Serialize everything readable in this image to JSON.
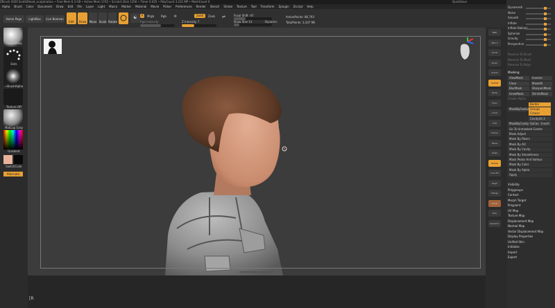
{
  "titlebar": {
    "text": "ZBrush 2020  Scott4Head_sculptnation  • Free Mem 6.3 GB • Active Mem 1745 • Scratch Disk 1356 • Timer 0.025 • PolyCount 3.221 MP • MeshCount 0",
    "quicksave": "QuickSave",
    "layout": "DefaultZScript"
  },
  "menu": [
    "Alpha",
    "Brush",
    "Color",
    "Document",
    "Draw",
    "Edit",
    "File",
    "Layer",
    "Light",
    "Macro",
    "Marker",
    "Material",
    "Movie",
    "Picker",
    "Preferences",
    "Render",
    "Stencil",
    "Stroke",
    "Texture",
    "Tool",
    "Transform",
    "Zplugin",
    "Zscript",
    "Help"
  ],
  "toolbar": {
    "home_page": "Home Page",
    "lightbox": "LightBox",
    "live_boolean": "Live Boolean",
    "edit": "Edit",
    "draw": "Draw",
    "move": "Move",
    "scale": "Scale",
    "rotate": "Rotate",
    "a": "A",
    "mrgb": "Mrgb",
    "rgb": "Rgb",
    "m": "M",
    "zadd": "Zadd",
    "zsub": "Zsub",
    "rgb_intensity": "Rgb Intensity",
    "z_intensity": "Z Intensity 7",
    "focal_shift": "Focal Shift -47",
    "draw_size": "Draw Size 13",
    "dynamic": "Dynamic",
    "active_points": "ActivePoints: 86,793",
    "total_points": "TotalPoints: 3,347 Mil",
    "coords": "-0.455,-0.063,0.364"
  },
  "left": {
    "brush": "ClayBuildup",
    "stroke": "Dots",
    "alpha": "~BrushAlpha",
    "texture": "Texture Off",
    "material": "MatCap Gray",
    "gradient": "Gradient",
    "switch_color": "SwitchColor",
    "alternate": "Alternate"
  },
  "rightshelf": [
    "BPR",
    "SPix 3",
    "Scroll",
    "Zoom",
    "Actual",
    "AAHalf",
    "Persp",
    "Floor",
    "Local",
    "XYZ",
    "Frame",
    "Move",
    "Scale",
    "Rotate",
    "Line Fill",
    "PolyF",
    "Transp",
    "Ghost",
    "Solo",
    "Dynamic"
  ],
  "rightpanel": {
    "top_items": [
      "Dynamesh",
      "Noise",
      "Smooth",
      "Inflate",
      "Inflate Balloon",
      "Spherize",
      "Gravity",
      "Perspective"
    ],
    "reverse": [
      "Reverse To Brush",
      "Reverse To Mask",
      "Reverse To Polys"
    ],
    "masking_title": "Masking",
    "view_mask": "ViewMask",
    "inverse": "Inverse",
    "clear": "Clear",
    "mask_all": "MaskAll",
    "blur_mask": "BlurMask",
    "sharpen_mask": "SharpenMask",
    "grow_mask": "GrowMask",
    "shrink_mask": "ShrinkMask",
    "create_alpha": "Create Alpha",
    "mask_by_feature": "MaskByFeature",
    "border": "Border",
    "groups": "Groups",
    "crease": "Crease",
    "mask_by_cavity": "MaskByCavity",
    "cavity_intensity": "CavityInt 2",
    "sacs": "SaCav",
    "invert": "Invert",
    "mask_items": [
      "Go To Unmasked Center",
      "Mask Adjust",
      "Mask By Fibers",
      "Mask By AO",
      "Mask By Cavity",
      "Mask By Smoothness",
      "Mask Peaks And Valleys",
      "Mask By Color",
      "Mask By Alpha",
      "Apply"
    ],
    "lower_items": [
      "Visibility",
      "Polygroups",
      "Contact",
      "Morph Target",
      "Polypaint",
      "UV Map",
      "Texture Map",
      "Displacement Map",
      "Normal Map",
      "Vector Displacement Map",
      "Display Properties",
      "Unified Skin",
      "Initialize",
      "Import",
      "Export"
    ]
  },
  "bottom": {
    "cursor": "[R"
  },
  "colors": {
    "accent": "#e8a033",
    "bg": "#2a2a2a",
    "canvas": "#3c3c3c"
  }
}
